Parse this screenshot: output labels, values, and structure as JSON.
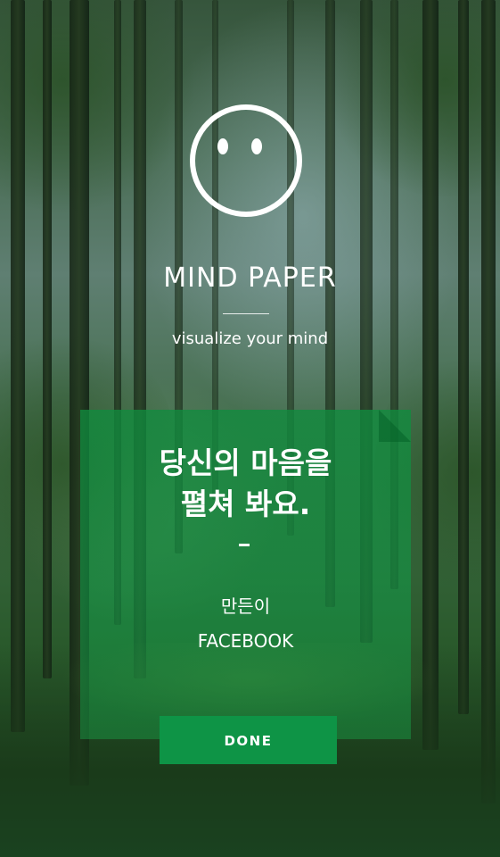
{
  "app": {
    "title": "MIND PAPER",
    "tagline": "visualize your mind",
    "logo_icon": "smiley-face-icon"
  },
  "card": {
    "headline_line1": "당신의 마음을",
    "headline_line2": "펼쳐 봐요.",
    "separator": "-",
    "maker_label": "만든이",
    "maker_link": "FACEBOOK"
  },
  "actions": {
    "done_label": "DONE"
  },
  "colors": {
    "accent_green": "#0e9446",
    "card_green": "#108c3e",
    "text": "#ffffff"
  }
}
